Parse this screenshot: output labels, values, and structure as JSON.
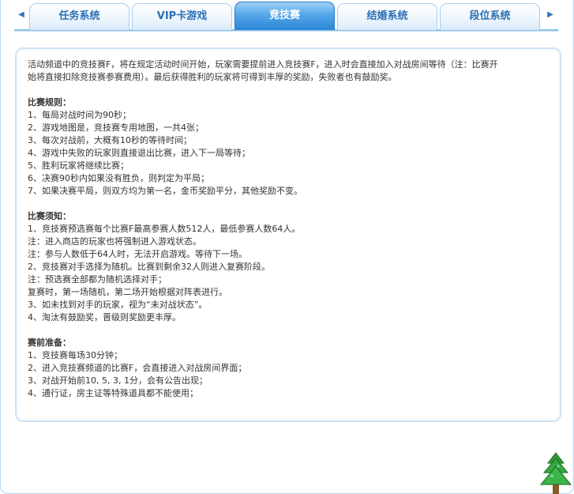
{
  "tabs": [
    {
      "label": "任务系统",
      "active": false
    },
    {
      "label": "VIP卡游戏",
      "active": false
    },
    {
      "label": "竞技赛",
      "active": true
    },
    {
      "label": "结婚系统",
      "active": false
    },
    {
      "label": "段位系统",
      "active": false
    }
  ],
  "nav": {
    "prev_icon": "◀",
    "next_icon": "▶"
  },
  "content": {
    "intro_1": "活动频道中的竞技赛F，将在规定活动时间开始，玩家需要提前进入竞技赛F，进入时会直接加入对战房间等待（注：比赛开",
    "intro_2": "始将直接扣除竞技赛参赛费用）。最后获得胜利的玩家将可得到丰厚的奖励，失败者也有鼓励奖。",
    "rules_title": "比赛规则：",
    "rules": [
      "1、每局对战时间为90秒；",
      "2、游戏地图是，竞技赛专用地图，一共4张；",
      "3、每次对战前，大概有10秒的等待时间；",
      "4、游戏中失败的玩家则直接退出比赛，进入下一局等待；",
      "5、胜利玩家将继续比赛；",
      "6、决赛90秒内如果没有胜负，则判定为平局；",
      "7、如果决赛平局，则双方均为第一名，金币奖励平分，其他奖励不变。"
    ],
    "notice_title": "比赛须知：",
    "notices": [
      "1、竞技赛预选赛每个比赛F最高参赛人数512人，最低参赛人数64人。",
      "注：进入商店的玩家也将强制进入游戏状态。",
      "注：参与人数低于64人时，无法开启游戏。等待下一场。",
      "2、竞技赛对手选择为随机。比赛到剩余32人则进入复赛阶段。",
      "注：预选赛全部都为随机选择对手；",
      "复赛时，第一场随机，第二场开始根据对阵表进行。",
      "3、如未找到对手的玩家，视为“未对战状态”。",
      "4、淘汰有鼓励奖，晋级则奖励更丰厚。"
    ],
    "prep_title": "赛前准备：",
    "preps": [
      "1、竞技赛每场30分钟；",
      "2、进入竞技赛频道的比赛F，会直接进入对战房间界面；",
      "3、对战开始前10, 5, 3, 1分，会有公告出现；",
      "4、通行证，房主证等特殊道具都不能使用；"
    ]
  },
  "colors": {
    "active_tab": "#2a86d6",
    "tab_text": "#2b6fb4",
    "border": "#cfe3f6",
    "body_text": "#333333"
  },
  "icons": {
    "corner": "tree-icon"
  }
}
